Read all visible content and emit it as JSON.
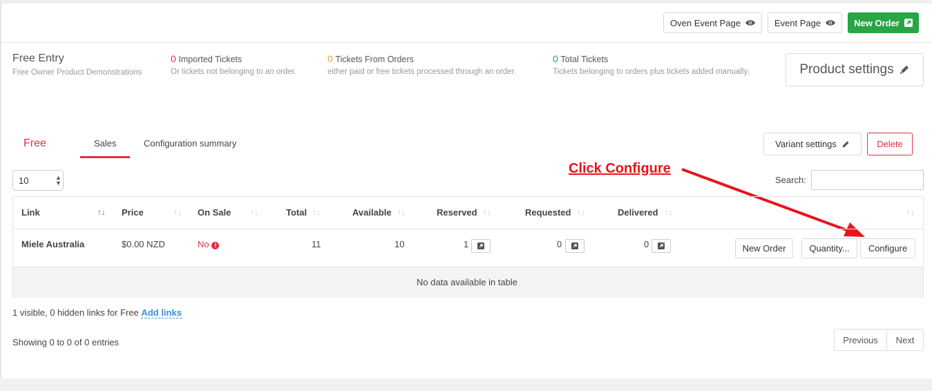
{
  "toolbar": {
    "oven_event_page_label": "Oven Event Page",
    "event_page_label": "Event Page",
    "new_order_label": "New Order"
  },
  "product": {
    "title": "Free Entry",
    "subtitle": "Free Owner Product Demonstrations",
    "settings_label": "Product settings"
  },
  "stats": [
    {
      "value": "0",
      "label": "Imported Tickets",
      "desc": "Or tickets not belonging to an order.",
      "color": "#e03040"
    },
    {
      "value": "0",
      "label": "Tickets From Orders",
      "desc": "either paid or free tickets processed through an order.",
      "color": "#f0a020"
    },
    {
      "value": "0",
      "label": "Total Tickets",
      "desc": "Tickets belonging to orders plus tickets added manually.",
      "color": "#27a645"
    }
  ],
  "variant": {
    "name": "Free",
    "tabs": [
      "Sales",
      "Configuration summary"
    ],
    "settings_label": "Variant settings",
    "delete_label": "Delete"
  },
  "annotation": {
    "text": "Click Configure",
    "color": "#e8141b"
  },
  "table": {
    "page_size": "10",
    "search_label": "Search:",
    "search_value": "",
    "columns": [
      "Link",
      "Price",
      "On Sale",
      "Total",
      "Available",
      "Reserved",
      "Requested",
      "Delivered"
    ],
    "row": {
      "link": "Miele Australia",
      "price": "$0.00 NZD",
      "on_sale": "No",
      "total": "11",
      "available": "10",
      "reserved": "1",
      "requested": "0",
      "delivered": "0",
      "actions": [
        "New Order",
        "Quantity...",
        "Configure"
      ]
    },
    "empty_message": "No data available in table"
  },
  "footer": {
    "links_summary": "1 visible, 0 hidden links for Free",
    "add_links_label": "Add links",
    "showing": "Showing 0 to 0 of 0 entries",
    "previous_label": "Previous",
    "next_label": "Next"
  }
}
